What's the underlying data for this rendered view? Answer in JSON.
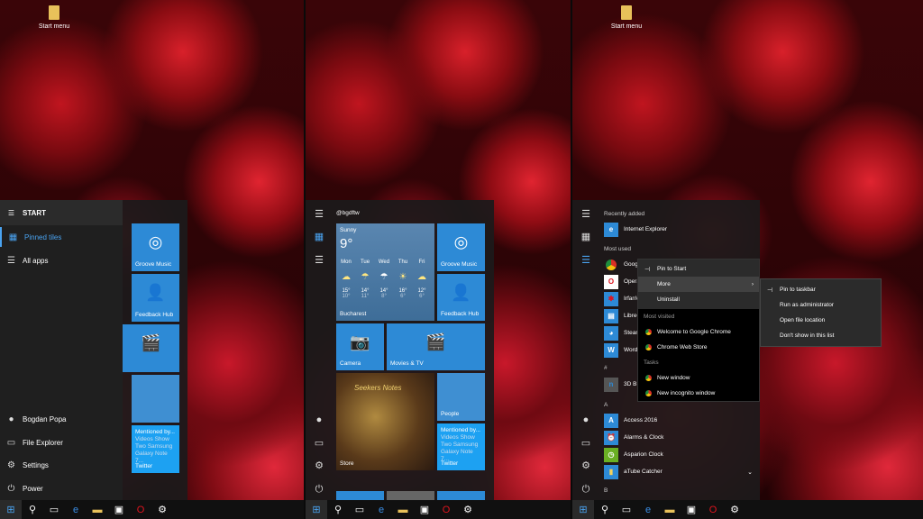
{
  "desktop": {
    "icon_label": "Start menu"
  },
  "panel1": {
    "title": "START",
    "nav": [
      {
        "label": "Pinned tiles",
        "icon": "pinned-tiles-icon"
      },
      {
        "label": "All apps",
        "icon": "list-icon"
      }
    ],
    "bottom": [
      {
        "label": "Bogdan Popa",
        "icon": "avatar"
      },
      {
        "label": "File Explorer",
        "icon": "file-explorer-icon"
      },
      {
        "label": "Settings",
        "icon": "gear-icon"
      },
      {
        "label": "Power",
        "icon": "power-icon"
      }
    ],
    "tiles": {
      "groove": "Groove Music",
      "feedback": "Feedback Hub",
      "twitter_title": "Mentioned by...",
      "twitter_body": "Videos Show Two Samsung Galaxy Note 7...",
      "twitter": "Twitter"
    }
  },
  "panel2": {
    "user": "@bgdftw",
    "weather": {
      "condition": "Sunny",
      "temp": "9°",
      "city": "Bucharest",
      "days": [
        {
          "d": "Mon",
          "hi": "15°",
          "lo": "10°",
          "icon": "☁"
        },
        {
          "d": "Tue",
          "hi": "14°",
          "lo": "11°",
          "icon": "☂"
        },
        {
          "d": "Wed",
          "hi": "14°",
          "lo": "8°",
          "icon": "☂"
        },
        {
          "d": "Thu",
          "hi": "16°",
          "lo": "6°",
          "icon": "☀"
        },
        {
          "d": "Fri",
          "hi": "12°",
          "lo": "6°",
          "icon": "☁"
        }
      ]
    },
    "tiles": {
      "groove": "Groove Music",
      "feedback": "Feedback Hub",
      "camera": "Camera",
      "movies": "Movies & TV",
      "store": "Store",
      "store_game": "Seekers Notes",
      "people": "People",
      "twitter_title": "Mentioned by...",
      "twitter_body": "Videos Show Two Samsung Galaxy Note 7...",
      "twitter": "Twitter"
    }
  },
  "panel3": {
    "recently_added": "Recently added",
    "recent_app": "Internet Explorer",
    "most_used": "Most used",
    "most_used_apps": [
      "Goog",
      "Opera",
      "IrfanV",
      "LibreO",
      "Steam",
      "Word"
    ],
    "hash": "#",
    "hash_app": "3D B",
    "letter_a": "A",
    "a_apps": [
      "Access 2016",
      "Alarms & Clock",
      "Asparion Clock",
      "aTube Catcher"
    ],
    "letter_b": "B",
    "context": {
      "pin_start": "Pin to Start",
      "more": "More",
      "uninstall": "Uninstall",
      "most_visited": "Most visited",
      "visited": [
        "Welcome to Google Chrome",
        "Chrome Web Store"
      ],
      "tasks": "Tasks",
      "task_items": [
        "New window",
        "New incognito window"
      ]
    },
    "submenu": [
      "Pin to taskbar",
      "Run as administrator",
      "Open file location",
      "Don't show in this list"
    ]
  },
  "colors": {
    "accent": "#2d8ad6",
    "menu_bg": "#1c1a1b"
  }
}
